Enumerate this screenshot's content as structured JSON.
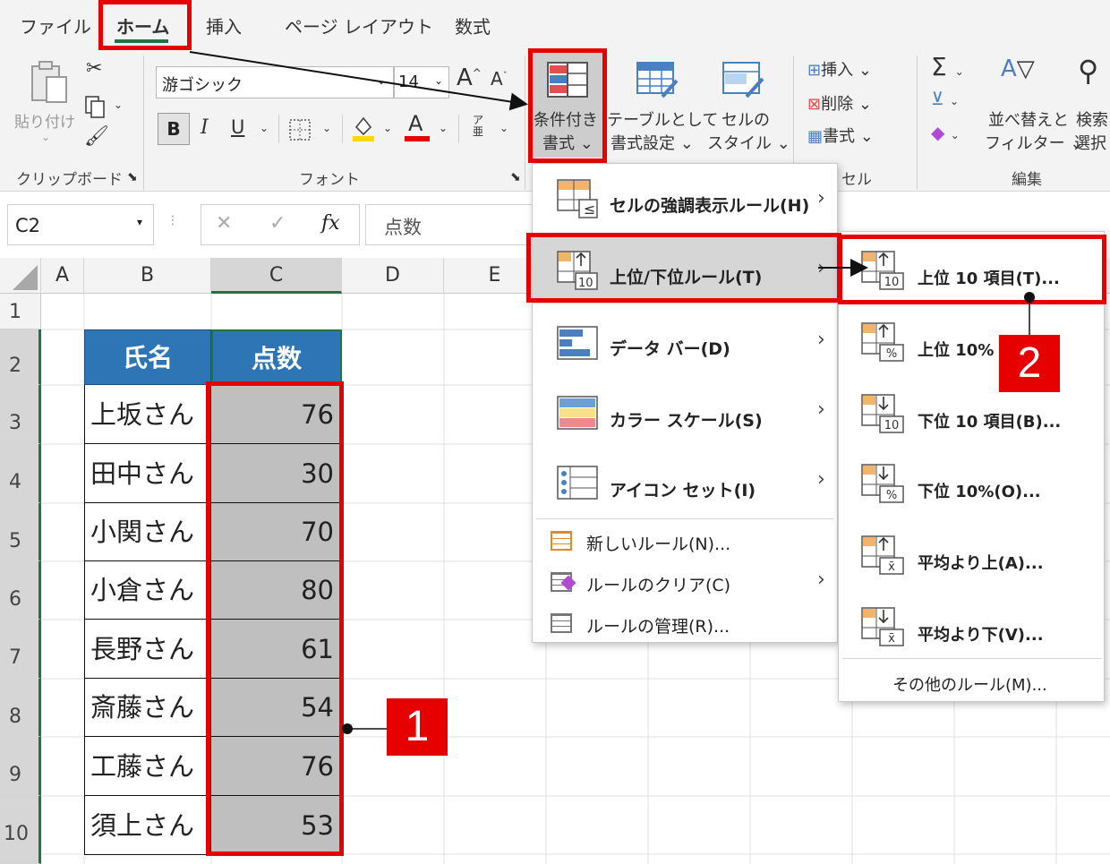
{
  "tabs": [
    "ファイル",
    "ホーム",
    "挿入",
    "ページ レイアウト",
    "数式"
  ],
  "clipboard": {
    "paste": "貼り付け",
    "group": "クリップボード"
  },
  "font": {
    "name": "游ゴシック",
    "size": "14",
    "group": "フォント",
    "bold": "B",
    "italic": "I",
    "underline": "U",
    "grow": "A",
    "shrink": "A"
  },
  "styles": {
    "cond_line1": "条件付き",
    "cond_line2": "書式",
    "table_line1": "テーブルとして",
    "table_line2": "書式設定",
    "cell_line1": "セルの",
    "cell_line2": "スタイル"
  },
  "cells_group": {
    "insert": "挿入",
    "delete": "削除",
    "format": "書式",
    "group": "セル"
  },
  "editing": {
    "sort_line1": "並べ替えと",
    "sort_line2": "フィルター",
    "find_line1": "検索",
    "find_line2": "選択",
    "group": "編集"
  },
  "formula_bar": {
    "name_box": "C2",
    "fx": "fx",
    "value": "点数"
  },
  "columns": [
    "A",
    "B",
    "C",
    "D",
    "E"
  ],
  "rows": [
    "1",
    "2",
    "3",
    "4",
    "5",
    "6",
    "7",
    "8",
    "9",
    "10"
  ],
  "table": {
    "headers": [
      "氏名",
      "点数"
    ],
    "rows": [
      {
        "name": "上坂さん",
        "score": "76"
      },
      {
        "name": "田中さん",
        "score": "30"
      },
      {
        "name": "小関さん",
        "score": "70"
      },
      {
        "name": "小倉さん",
        "score": "80"
      },
      {
        "name": "長野さん",
        "score": "61"
      },
      {
        "name": "斎藤さん",
        "score": "54"
      },
      {
        "name": "工藤さん",
        "score": "76"
      },
      {
        "name": "須上さん",
        "score": "53"
      }
    ]
  },
  "menu": {
    "highlight": "セルの強調表示ルール(H)",
    "topbottom": "上位/下位ルール(T)",
    "databar": "データ バー(D)",
    "colorscale": "カラー スケール(S)",
    "iconset": "アイコン セット(I)",
    "newrule": "新しいルール(N)...",
    "clear": "ルールのクリア(C)",
    "manage": "ルールの管理(R)..."
  },
  "submenu": {
    "top10": "上位 10 項目(T)...",
    "top10pct": "上位 10%",
    "bottom10": "下位 10 項目(B)...",
    "bottom10pct": "下位 10%(O)...",
    "above": "平均より上(A)...",
    "below": "平均より下(V)...",
    "more": "その他のルール(M)...",
    "icon_10": "10",
    "icon_pct": "%",
    "icon_avg": "x̄"
  },
  "callouts": {
    "one": "1",
    "two": "2"
  },
  "colors": {
    "accent_red": "#e60000",
    "header_blue": "#2e75b6",
    "selected_gray": "#bfbfbf",
    "excel_green": "#217346"
  }
}
